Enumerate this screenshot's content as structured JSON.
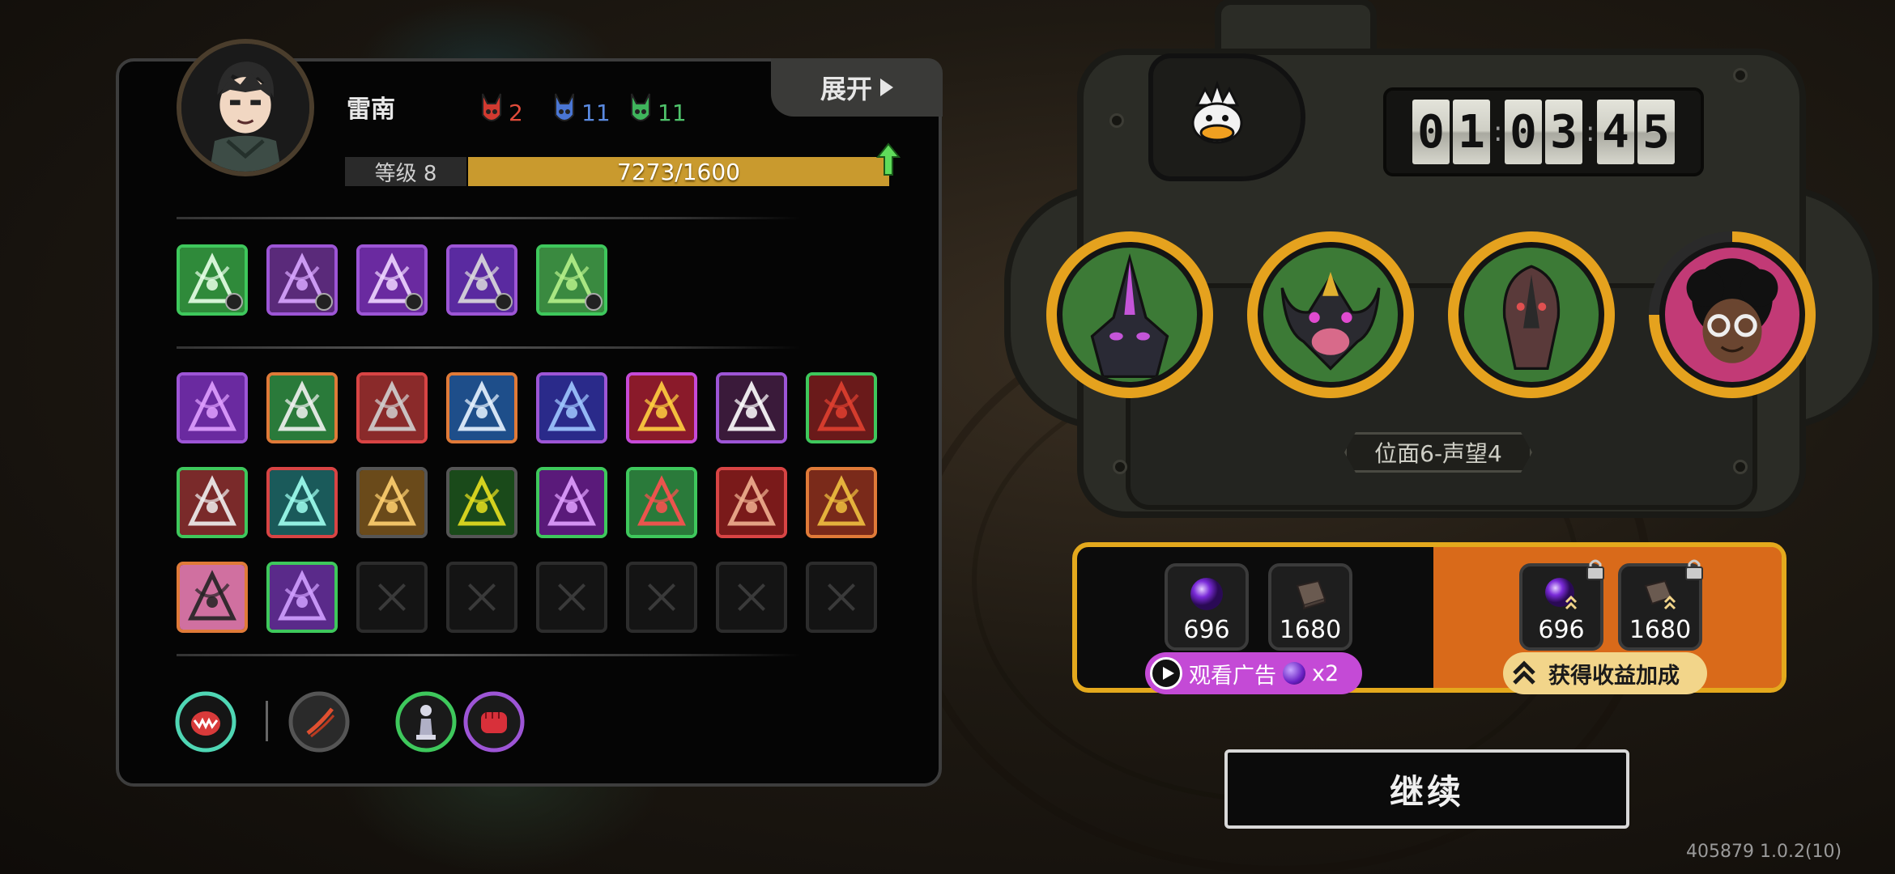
{
  "player": {
    "name": "雷南",
    "level_label": "等级 8",
    "xp_text": "7273/1600",
    "xp_fill_fraction": 1.0,
    "resources": [
      {
        "icon": "red-horned-mask-icon",
        "value": "2",
        "color": "#e04b3a"
      },
      {
        "icon": "blue-horned-mask-icon",
        "value": "11",
        "color": "#5a8ae0"
      },
      {
        "icon": "green-horned-mask-icon",
        "value": "11",
        "color": "#4fc36b"
      }
    ]
  },
  "expand_label": "展开",
  "skills_top": [
    {
      "icon": "crossed-blades-skill-icon",
      "border": "#3ec85c"
    },
    {
      "icon": "eye-rune-skill-icon",
      "border": "#9d55d6"
    },
    {
      "icon": "claw-rune-skill-icon",
      "border": "#9d55d6"
    },
    {
      "icon": "machine-skill-icon",
      "border": "#9d55d6"
    },
    {
      "icon": "vine-skill-icon",
      "border": "#3ec85c"
    }
  ],
  "skills_grid": [
    {
      "icon": "purple-blob-icon",
      "border": "#9d55d6"
    },
    {
      "icon": "green-shield-icon",
      "border": "#e07a38"
    },
    {
      "icon": "crossed-swords-icon",
      "border": "#d84444"
    },
    {
      "icon": "running-figure-icon",
      "border": "#e07a38"
    },
    {
      "icon": "blue-slash-icon",
      "border": "#9d55d6"
    },
    {
      "icon": "lightning-bolt-icon",
      "border": "#c64ad8"
    },
    {
      "icon": "claw-marks-icon",
      "border": "#9d55d6"
    },
    {
      "icon": "red-beast-icon",
      "border": "#3ec85c"
    },
    {
      "icon": "red-strike-icon",
      "border": "#3ec85c"
    },
    {
      "icon": "cyan-wave-icon",
      "border": "#d84444"
    },
    {
      "icon": "explosion-icon",
      "border": "#555555"
    },
    {
      "icon": "green-wing-icon",
      "border": "#555555"
    },
    {
      "icon": "purple-dash-icon",
      "border": "#3ec85c"
    },
    {
      "icon": "red-arrow-icon",
      "border": "#3ec85c"
    },
    {
      "icon": "fist-combo-icon",
      "border": "#d84444"
    },
    {
      "icon": "golden-helmet-icon",
      "border": "#e07a38"
    },
    {
      "icon": "howling-ghost-icon",
      "border": "#e07a38"
    },
    {
      "icon": "purple-hand-icon",
      "border": "#3ec85c"
    },
    {
      "icon": "empty-slot-icon",
      "border": "#2c2c2c"
    },
    {
      "icon": "empty-slot-icon",
      "border": "#2c2c2c"
    },
    {
      "icon": "empty-slot-icon",
      "border": "#2c2c2c"
    },
    {
      "icon": "empty-slot-icon",
      "border": "#2c2c2c"
    },
    {
      "icon": "empty-slot-icon",
      "border": "#2c2c2c"
    },
    {
      "icon": "empty-slot-icon",
      "border": "#2c2c2c"
    }
  ],
  "relics": [
    {
      "icon": "roaring-mouth-relic-icon",
      "ring": "#4fd6b4"
    },
    {
      "icon": "claw-relic-icon",
      "ring": "#555555"
    },
    {
      "icon": "chess-pawn-relic-icon",
      "ring": "#3ec85c"
    },
    {
      "icon": "red-fist-relic-icon",
      "ring": "#9d55d6"
    }
  ],
  "timer": {
    "digits": [
      "0",
      "1",
      "0",
      "3",
      "4",
      "5"
    ]
  },
  "team_emblem": "duck-knight-emblem-icon",
  "heroes": [
    {
      "icon": "hooded-purple-hero-icon",
      "bg": "#3c7a36"
    },
    {
      "icon": "horned-demon-hero-icon",
      "bg": "#3c7a36"
    },
    {
      "icon": "dark-beast-hero-icon",
      "bg": "#3c7a36"
    },
    {
      "icon": "afro-glasses-hero-icon",
      "bg": "#c23a76",
      "progress": 0.75
    }
  ],
  "location_label": "位面6-声望4",
  "rewards": {
    "free": [
      {
        "icon": "purple-orb-icon",
        "value": "696"
      },
      {
        "icon": "book-icon",
        "value": "1680"
      }
    ],
    "bonus": [
      {
        "icon": "purple-orb-boost-icon",
        "value": "696",
        "locked": true
      },
      {
        "icon": "book-boost-icon",
        "value": "1680",
        "locked": true
      }
    ],
    "ad_label": "观看广告",
    "ad_multiplier": "x2",
    "bonus_label": "获得收益加成"
  },
  "continue_label": "继续",
  "version": "405879 1.0.2(10)"
}
